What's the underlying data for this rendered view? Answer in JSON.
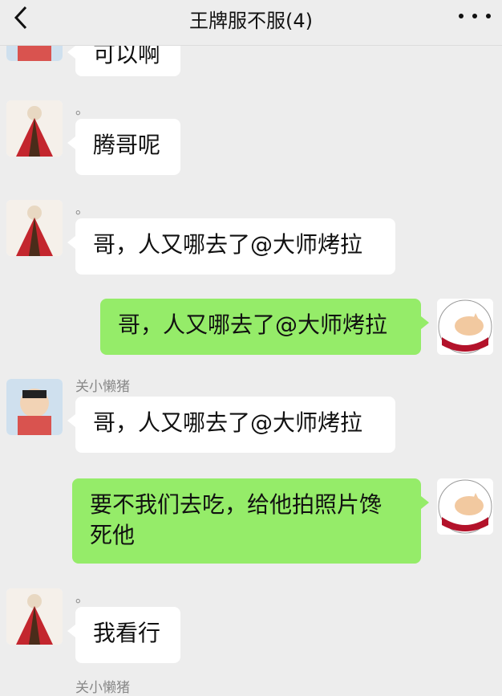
{
  "header": {
    "title": "王牌服不服(4)"
  },
  "messages": [
    {
      "text": "可以啊"
    },
    {
      "sender": "。",
      "text": "腾哥呢"
    },
    {
      "sender": "。",
      "text": "哥，人又哪去了@大师烤拉"
    },
    {
      "text": "哥，人又哪去了@大师烤拉"
    },
    {
      "sender": "关小懒猪",
      "text": "哥，人又哪去了@大师烤拉"
    },
    {
      "text": "要不我们去吃，给他拍照片馋死他"
    },
    {
      "sender": "。",
      "text": "我看行"
    },
    {
      "sender": "关小懒猪"
    }
  ],
  "colors": {
    "background": "#ededed",
    "incoming_bubble": "#ffffff",
    "outgoing_bubble": "#95ec69"
  },
  "icons": [
    "back-arrow-icon",
    "more-dots-icon"
  ]
}
